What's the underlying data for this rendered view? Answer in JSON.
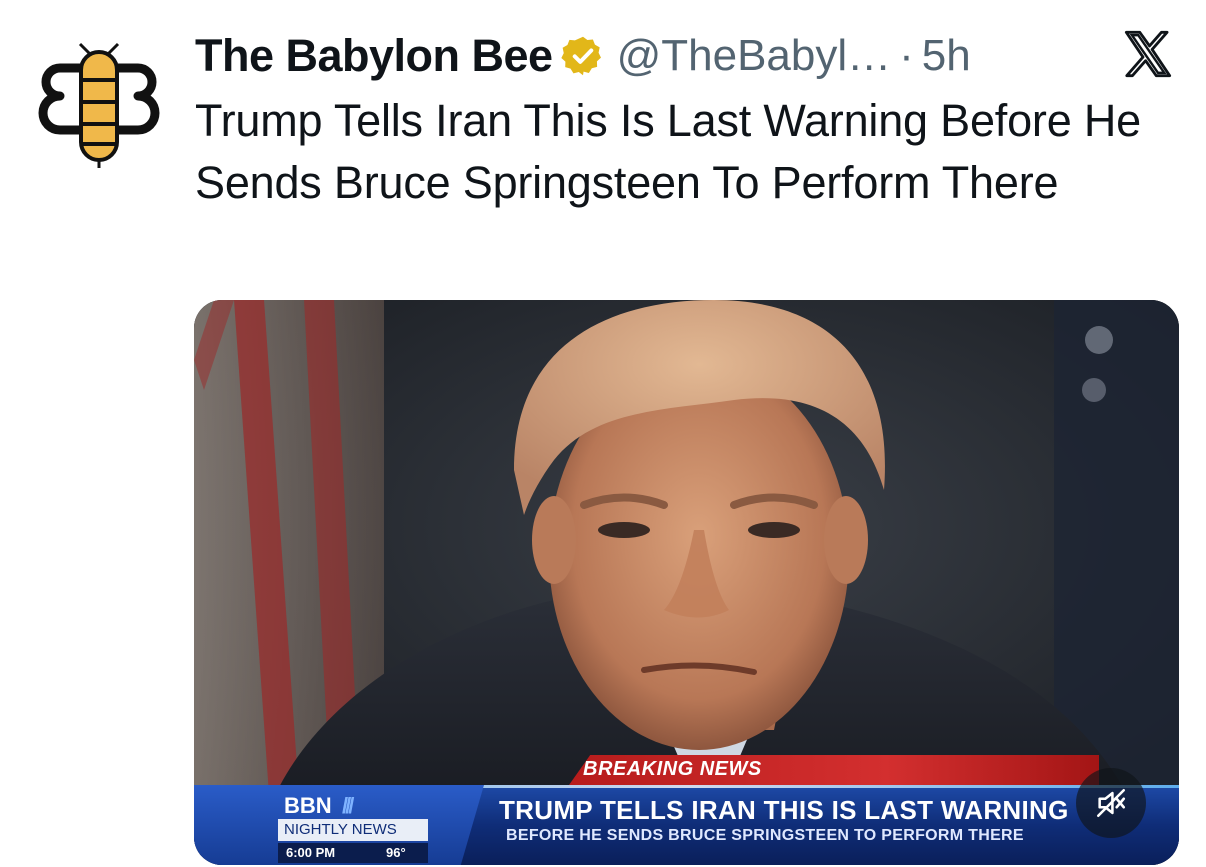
{
  "tweet": {
    "display_name": "The Babylon Bee",
    "handle": "@TheBabyl…",
    "separator": "·",
    "time": "5h",
    "text": "Trump Tells Iran This Is Last Warning Before He Sends Bruce Springsteen To Perform There",
    "verified_color": "#e2b719"
  },
  "icons": {
    "avatar": "babylon-bee-logo",
    "verified": "verified-badge-icon",
    "platform": "x-logo-icon",
    "mute": "muted-speaker-icon"
  },
  "media": {
    "lower_third": {
      "banner": "BREAKING NEWS",
      "network": "BBN",
      "network_slashes": "///",
      "program": "NIGHTLY NEWS",
      "clock": "6:00 PM",
      "temperature": "96°",
      "headline": "TRUMP TELLS IRAN THIS IS LAST WARNING",
      "subheadline": "BEFORE HE SENDS BRUCE SPRINGSTEEN TO PERFORM THERE"
    }
  },
  "colors": {
    "bee_yellow": "#f0b84a",
    "breaking_red": "#c62828",
    "ticker_blue": "#123a8f",
    "handle_gray": "#536471"
  }
}
